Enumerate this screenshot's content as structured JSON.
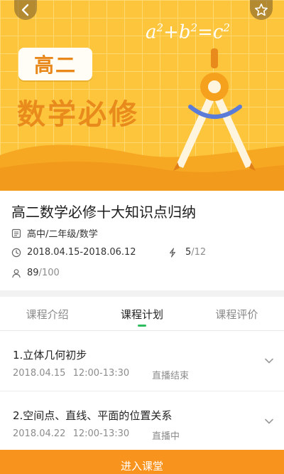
{
  "hero": {
    "grade_label": "高二",
    "subject_label": "数学必修",
    "formula": {
      "a": "a",
      "b": "b",
      "c": "c",
      "exp": "2",
      "plus": "+",
      "eq": "="
    },
    "colors": {
      "background": "#fcc53c",
      "accent": "#e98a1c",
      "compass_head": "#f5a11e",
      "arc": "#5a7bd8"
    },
    "icons": {
      "back": "chevron-left-icon",
      "favorite": "star-outline-icon",
      "art": "compass-icon"
    }
  },
  "course": {
    "title": "高二数学必修十大知识点归纳",
    "grade_path": "高中/二年级/数学",
    "date_range": "2018.04.15-2018.06.12",
    "lessons_done": "5",
    "lessons_total": "/12",
    "students_enrolled": "89",
    "students_capacity": "/100"
  },
  "tabs": [
    {
      "label": "课程介绍",
      "active": false
    },
    {
      "label": "课程计划",
      "active": true
    },
    {
      "label": "课程评价",
      "active": false
    }
  ],
  "lessons": [
    {
      "title": "1.立体几何初步",
      "date": "2018.04.15",
      "time": "12:00-13:30",
      "status": "直播结束"
    },
    {
      "title": "2.空间点、直线、平面的位置关系",
      "date": "2018.04.22",
      "time": "12:00-13:30",
      "status": "直播中"
    }
  ],
  "footer": {
    "enter_label": "进入课堂",
    "color": "#f8931d"
  },
  "theme": {
    "tab_indicator": "#2dbd5f"
  }
}
